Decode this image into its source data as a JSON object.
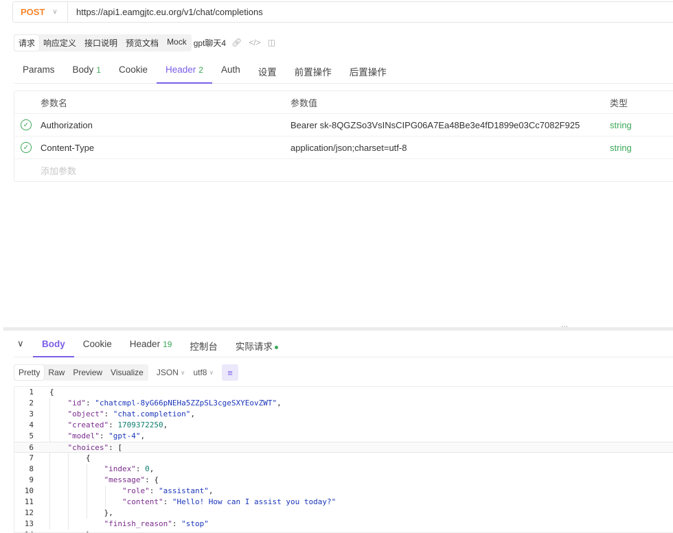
{
  "request": {
    "method": "POST",
    "url": "https://api1.eamgjtc.eu.org/v1/chat/completions"
  },
  "subbar": {
    "segments": [
      "请求",
      "响应定义",
      "接口说明",
      "预览文档",
      "Mock"
    ],
    "title": "gpt聊天4"
  },
  "req_tabs": [
    {
      "label": "Params",
      "count": ""
    },
    {
      "label": "Body",
      "count": "1"
    },
    {
      "label": "Cookie",
      "count": ""
    },
    {
      "label": "Header",
      "count": "2"
    },
    {
      "label": "Auth",
      "count": ""
    },
    {
      "label": "设置",
      "count": ""
    },
    {
      "label": "前置操作",
      "count": ""
    },
    {
      "label": "后置操作",
      "count": ""
    }
  ],
  "params": {
    "headers": {
      "name": "参数名",
      "value": "参数值",
      "type": "类型"
    },
    "rows": [
      {
        "name": "Authorization",
        "value": "Bearer sk-8QGZSo3VsINsCIPG06A7Ea48Be3e4fD1899e03Cc7082F925",
        "type": "string"
      },
      {
        "name": "Content-Type",
        "value": "application/json;charset=utf-8",
        "type": "string"
      }
    ],
    "add_placeholder": "添加参数"
  },
  "res_tabs": [
    {
      "label": "Body",
      "count": ""
    },
    {
      "label": "Cookie",
      "count": ""
    },
    {
      "label": "Header",
      "count": "19"
    },
    {
      "label": "控制台",
      "count": ""
    },
    {
      "label": "实际请求",
      "count": ""
    }
  ],
  "res_toolbar": {
    "views": [
      "Pretty",
      "Raw",
      "Preview",
      "Visualize"
    ],
    "format": "JSON",
    "encoding": "utf8"
  },
  "code_lines": [
    "{",
    "    \"id\": \"chatcmpl-8yG66pNEHa5ZZpSL3cgeSXYEovZWT\",",
    "    \"object\": \"chat.completion\",",
    "    \"created\": 1709372250,",
    "    \"model\": \"gpt-4\",",
    "    \"choices\": [",
    "        {",
    "            \"index\": 0,",
    "            \"message\": {",
    "                \"role\": \"assistant\",",
    "                \"content\": \"Hello! How can I assist you today?\"",
    "            },",
    "            \"finish_reason\": \"stop\"",
    "        }"
  ],
  "colors": {
    "accent": "#7b5ee8",
    "method": "#f7852c",
    "success": "#3aa757"
  }
}
